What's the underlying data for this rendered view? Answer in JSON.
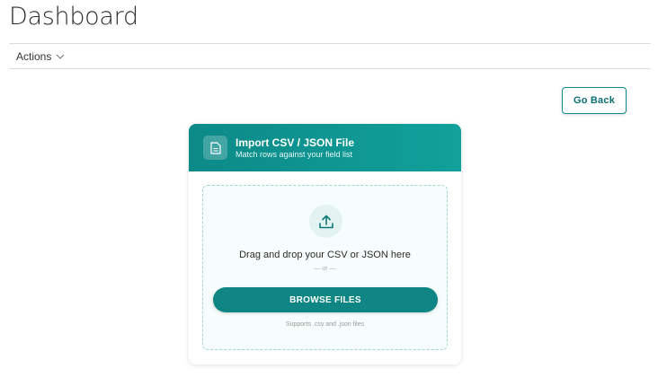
{
  "page": {
    "title": "Dashboard"
  },
  "actions": {
    "label": "Actions"
  },
  "go_back": {
    "label": "Go Back"
  },
  "import_card": {
    "title": "Import CSV / JSON File",
    "subtitle": "Match rows against your field list",
    "drop_text": "Drag and drop your CSV or JSON here",
    "or_text": "— or —",
    "browse_label": "BROWSE FILES",
    "supports_text": "Supports .csv and .json files"
  },
  "colors": {
    "accent": "#0f8584",
    "header_gradient_start": "#0c8a88",
    "header_gradient_end": "#11a09b",
    "dropzone_border": "#9fd6d2",
    "dropzone_bg": "#f7fdfc"
  },
  "icons": {
    "actions_chevron": "chevron-down-icon",
    "header_icon": "document-icon",
    "upload_icon": "upload-icon"
  }
}
